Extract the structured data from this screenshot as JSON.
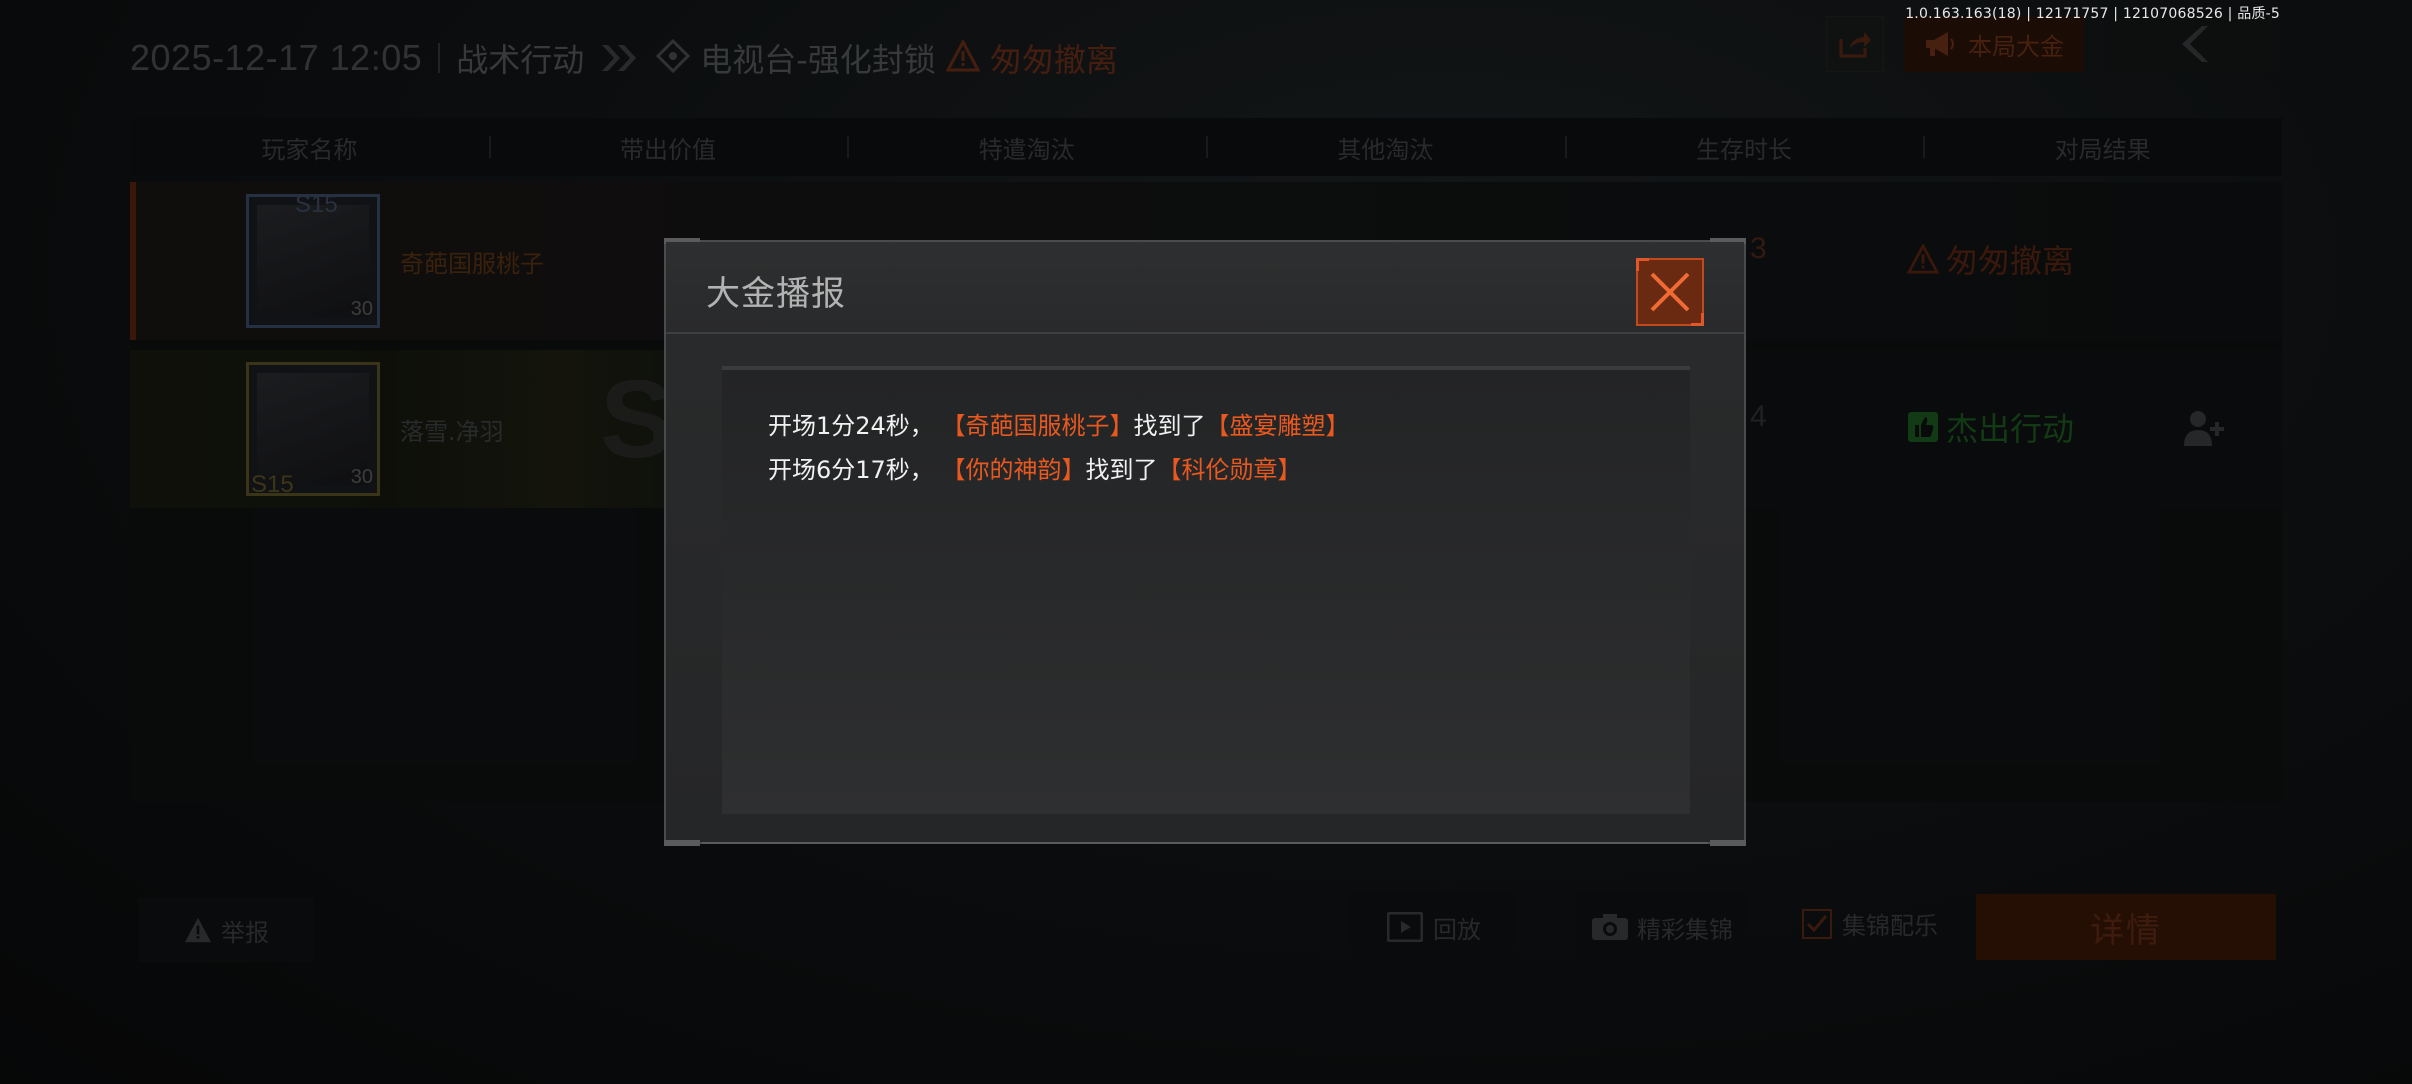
{
  "version_text": "1.0.163.163(18) | 12171757 | 12107068526 | 品质-5",
  "header": {
    "date": "2025-12-17 12:05",
    "mode": "战术行动",
    "map": "电视台-强化封锁",
    "result": "匆匆撤离",
    "result_color": "#e05a28",
    "big_money_label": "本局大金"
  },
  "table": {
    "columns": [
      "玩家名称",
      "带出价值",
      "特遣淘汰",
      "其他淘汰",
      "生存时长",
      "对局结果"
    ],
    "rows": [
      {
        "player_name": "奇葩国服桃子",
        "season_badge": "S15",
        "level": "30",
        "survive_partial": "3",
        "result": "匆匆撤离"
      },
      {
        "player_name": "落雪.净羽",
        "season_badge": "S15",
        "level": "30",
        "survive_partial": "4",
        "result": "杰出行动"
      }
    ]
  },
  "bottom": {
    "report_label": "举报",
    "replay_label": "回放",
    "highlight_label": "精彩集锦",
    "bgm_label": "集锦配乐",
    "bgm_checked": true,
    "details_label": "详情"
  },
  "modal": {
    "title": "大金播报",
    "entries": [
      {
        "time": "开场1分24秒，",
        "player": "奇葩国服桃子",
        "verb": "找到了",
        "item": "盛宴雕塑"
      },
      {
        "time": "开场6分17秒，",
        "player": "你的神韵",
        "verb": "找到了",
        "item": "科伦勋章"
      }
    ]
  },
  "colors": {
    "accent_orange": "#e8581f",
    "success_green": "#2a8a2e"
  }
}
